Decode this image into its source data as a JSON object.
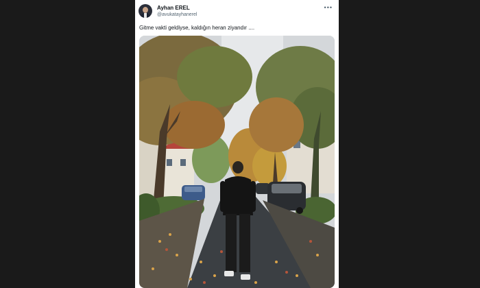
{
  "tweet": {
    "author_name": "Ayhan EREL",
    "author_handle": "@avukatayhanerel",
    "more_icon": "more-horizontal-icon",
    "more_label": "•••",
    "text": "Gitme vakti geldiyse, kaldığın heran ziyandır ...."
  },
  "colors": {
    "page_background": "#1a1a1a",
    "card_background": "#ffffff",
    "name_color": "#0f1419",
    "handle_color": "#536471"
  }
}
